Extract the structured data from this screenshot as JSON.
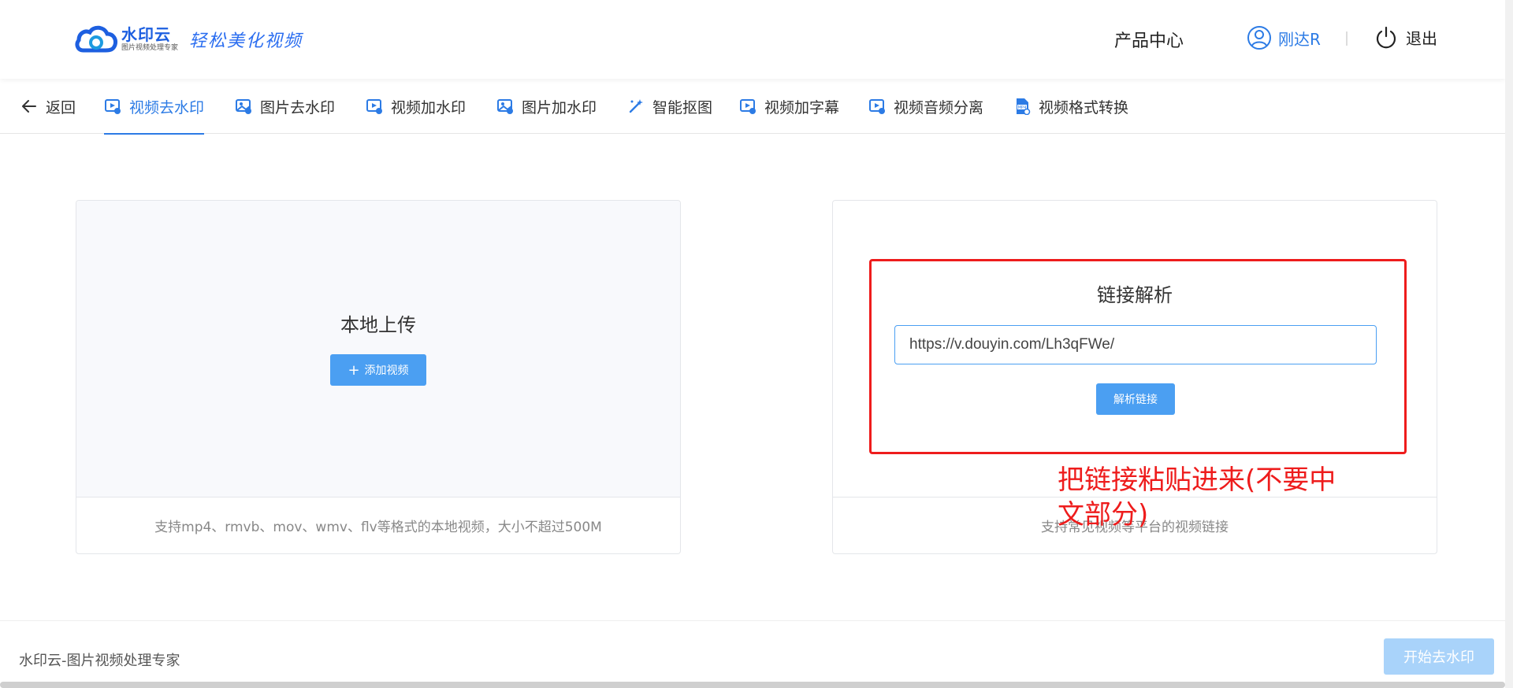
{
  "header": {
    "logo_name": "水印云",
    "logo_sub": "图片视频处理专家",
    "logo_slogan": "轻松美化视频",
    "products_label": "产品中心",
    "user_name": "刚达R",
    "logout_label": "退出"
  },
  "tabs": {
    "back_label": "返回",
    "items": [
      {
        "label": "视频去水印",
        "icon": "video-icon",
        "active": true
      },
      {
        "label": "图片去水印",
        "icon": "image-icon"
      },
      {
        "label": "视频加水印",
        "icon": "video-icon"
      },
      {
        "label": "图片加水印",
        "icon": "image-icon"
      },
      {
        "label": "智能抠图",
        "icon": "magic-wand-icon"
      },
      {
        "label": "视频加字幕",
        "icon": "video-icon"
      },
      {
        "label": "视频音频分离",
        "icon": "video-icon"
      },
      {
        "label": "视频格式转换",
        "icon": "mp4-file-icon"
      }
    ]
  },
  "local_upload": {
    "title": "本地上传",
    "add_button": "添加视频",
    "hint": "支持mp4、rmvb、mov、wmv、flv等格式的本地视频，大小不超过500M"
  },
  "link_parse": {
    "title": "链接解析",
    "input_value": "https://v.douyin.com/Lh3qFWe/",
    "parse_button": "解析链接",
    "hint": "支持常见视频等平台的视频链接"
  },
  "annotation": "把链接粘贴进来(不要中文部分)",
  "footer": {
    "text": "水印云-图片视频处理专家",
    "start_button": "开始去水印"
  },
  "colors": {
    "accent": "#2c7be5",
    "button": "#4b9ff2",
    "button_disabled": "#a9d3fa",
    "annotation_red": "#ee1c1c"
  }
}
